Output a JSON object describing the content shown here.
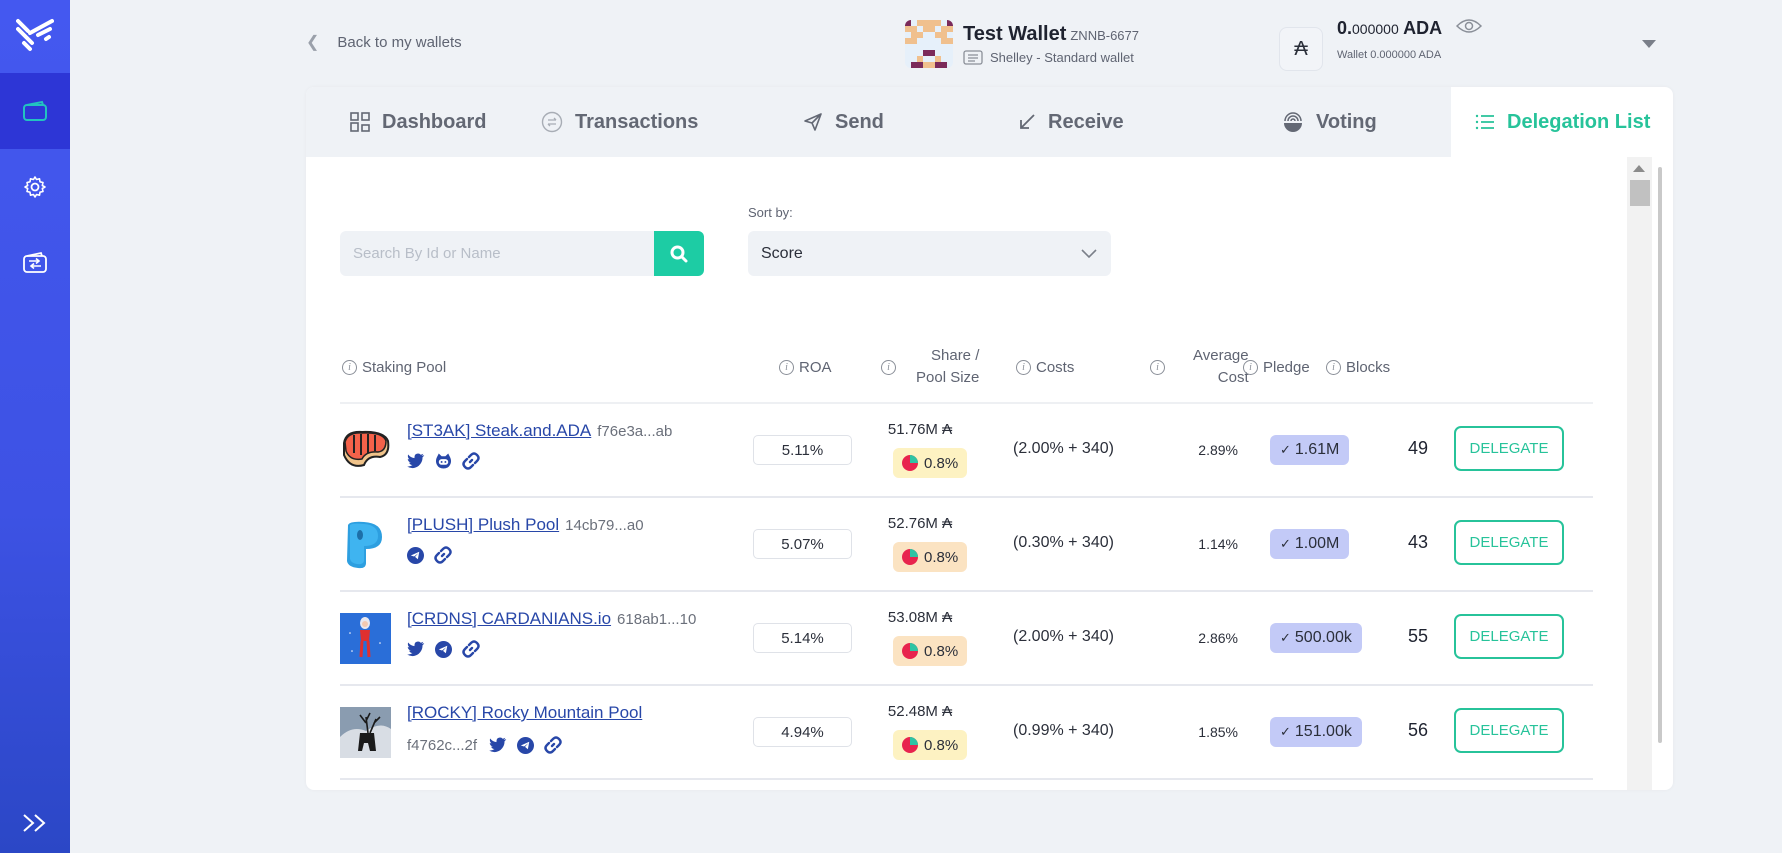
{
  "sidebar": {
    "items": [
      {
        "name": "wallets",
        "icon": "wallet-icon",
        "active": true
      },
      {
        "name": "settings",
        "icon": "gear-icon",
        "active": false
      },
      {
        "name": "transfer",
        "icon": "wallet-transfer-icon",
        "active": false
      }
    ],
    "expand_icon": "double-chevron-right-icon"
  },
  "header": {
    "back_label": "Back to my wallets",
    "wallet_name": "Test Wallet",
    "wallet_id": "ZNNB-6677",
    "wallet_type": "Shelley - Standard wallet",
    "currency_symbol": "₳",
    "balance_int": "0.",
    "balance_dec": "000000",
    "balance_unit": "ADA",
    "wallet_balance": "Wallet 0.000000 ADA"
  },
  "tabs": [
    {
      "label": "Dashboard",
      "icon": "dashboard-grid-icon",
      "active": false
    },
    {
      "label": "Transactions",
      "icon": "transactions-icon",
      "active": false
    },
    {
      "label": "Send",
      "icon": "send-plane-icon",
      "active": false
    },
    {
      "label": "Receive",
      "icon": "receive-arrow-icon",
      "active": false
    },
    {
      "label": "Voting",
      "icon": "voting-icon",
      "active": false
    },
    {
      "label": "Delegation List",
      "icon": "list-icon",
      "active": true
    }
  ],
  "search": {
    "placeholder": "Search By Id or Name",
    "value": ""
  },
  "sort": {
    "label": "Sort by:",
    "selected": "Score"
  },
  "table": {
    "columns": {
      "staking_pool": "Staking Pool",
      "roa": "ROA",
      "share_line1": "Share /",
      "share_line2": "Pool Size",
      "costs": "Costs",
      "avg_line1": "Average",
      "avg_line2": "Cost",
      "pledge": "Pledge",
      "blocks": "Blocks"
    },
    "delegate_label": "DELEGATE",
    "rows": [
      {
        "name": "[ST3AK] Steak.and.ADA",
        "id": "f76e3a...ab",
        "socials": [
          "twitter",
          "github",
          "link"
        ],
        "roa": "5.11%",
        "pool_size": "51.76M ₳",
        "share": "0.8%",
        "share_color": "#fdf2c2",
        "costs": "(2.00% + 340)",
        "avg_cost": "2.89%",
        "pledge": "1.61M",
        "blocks": "49"
      },
      {
        "name": "[PLUSH] Plush Pool",
        "id": "14cb79...a0",
        "socials": [
          "telegram",
          "link"
        ],
        "roa": "5.07%",
        "pool_size": "52.76M ₳",
        "share": "0.8%",
        "share_color": "#fbe3c2",
        "costs": "(0.30% + 340)",
        "avg_cost": "1.14%",
        "pledge": "1.00M",
        "blocks": "43"
      },
      {
        "name": "[CRDNS] CARDANIANS.io",
        "id": "618ab1...10",
        "socials": [
          "twitter",
          "telegram",
          "link"
        ],
        "roa": "5.14%",
        "pool_size": "53.08M ₳",
        "share": "0.8%",
        "share_color": "#fbe3c2",
        "costs": "(2.00% + 340)",
        "avg_cost": "2.86%",
        "pledge": "500.00k",
        "blocks": "55"
      },
      {
        "name": "[ROCKY] Rocky Mountain Pool",
        "id": "f4762c...2f",
        "socials": [
          "twitter",
          "telegram",
          "link"
        ],
        "roa": "4.94%",
        "pool_size": "52.48M ₳",
        "share": "0.8%",
        "share_color": "#fdf2c2",
        "costs": "(0.99% + 340)",
        "avg_cost": "1.85%",
        "pledge": "151.00k",
        "blocks": "56"
      }
    ]
  },
  "colors": {
    "accent": "#27c39a",
    "sidebar": "#4458f0",
    "link": "#2847a8",
    "pledge_badge": "#c3caf7"
  }
}
